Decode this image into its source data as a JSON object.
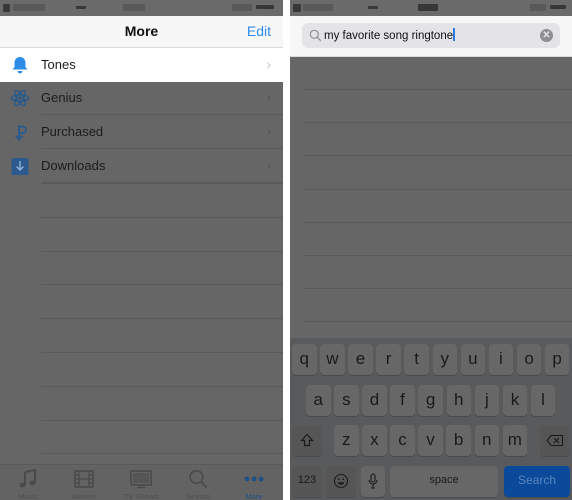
{
  "left_screen": {
    "navbar": {
      "title": "More",
      "edit_label": "Edit"
    },
    "menu_items": [
      {
        "label": "Tones",
        "icon": "bell-icon",
        "highlighted": true
      },
      {
        "label": "Genius",
        "icon": "atom-icon",
        "highlighted": false
      },
      {
        "label": "Purchased",
        "icon": "purchased-icon",
        "highlighted": false
      },
      {
        "label": "Downloads",
        "icon": "download-icon",
        "highlighted": false
      }
    ],
    "tabbar": [
      {
        "label": "Music",
        "icon": "music-note-icon",
        "active": false
      },
      {
        "label": "Movies",
        "icon": "film-icon",
        "active": false
      },
      {
        "label": "TV Shows",
        "icon": "tv-icon",
        "active": false
      },
      {
        "label": "Search",
        "icon": "search-icon",
        "active": false
      },
      {
        "label": "More",
        "icon": "more-dots-icon",
        "active": true
      }
    ]
  },
  "right_screen": {
    "search": {
      "query": "my favorite song ringtone",
      "clear_icon": "clear-icon"
    },
    "keyboard": {
      "row1": [
        "q",
        "w",
        "e",
        "r",
        "t",
        "y",
        "u",
        "i",
        "o",
        "p"
      ],
      "row2": [
        "a",
        "s",
        "d",
        "f",
        "g",
        "h",
        "j",
        "k",
        "l"
      ],
      "row3": [
        "z",
        "x",
        "c",
        "v",
        "b",
        "n",
        "m"
      ],
      "numbers_label": "123",
      "space_label": "space",
      "search_label": "Search"
    }
  },
  "colors": {
    "accent": "#2d8ce8",
    "dimmed_background": "#666666",
    "search_key": "#0b4a9a"
  }
}
